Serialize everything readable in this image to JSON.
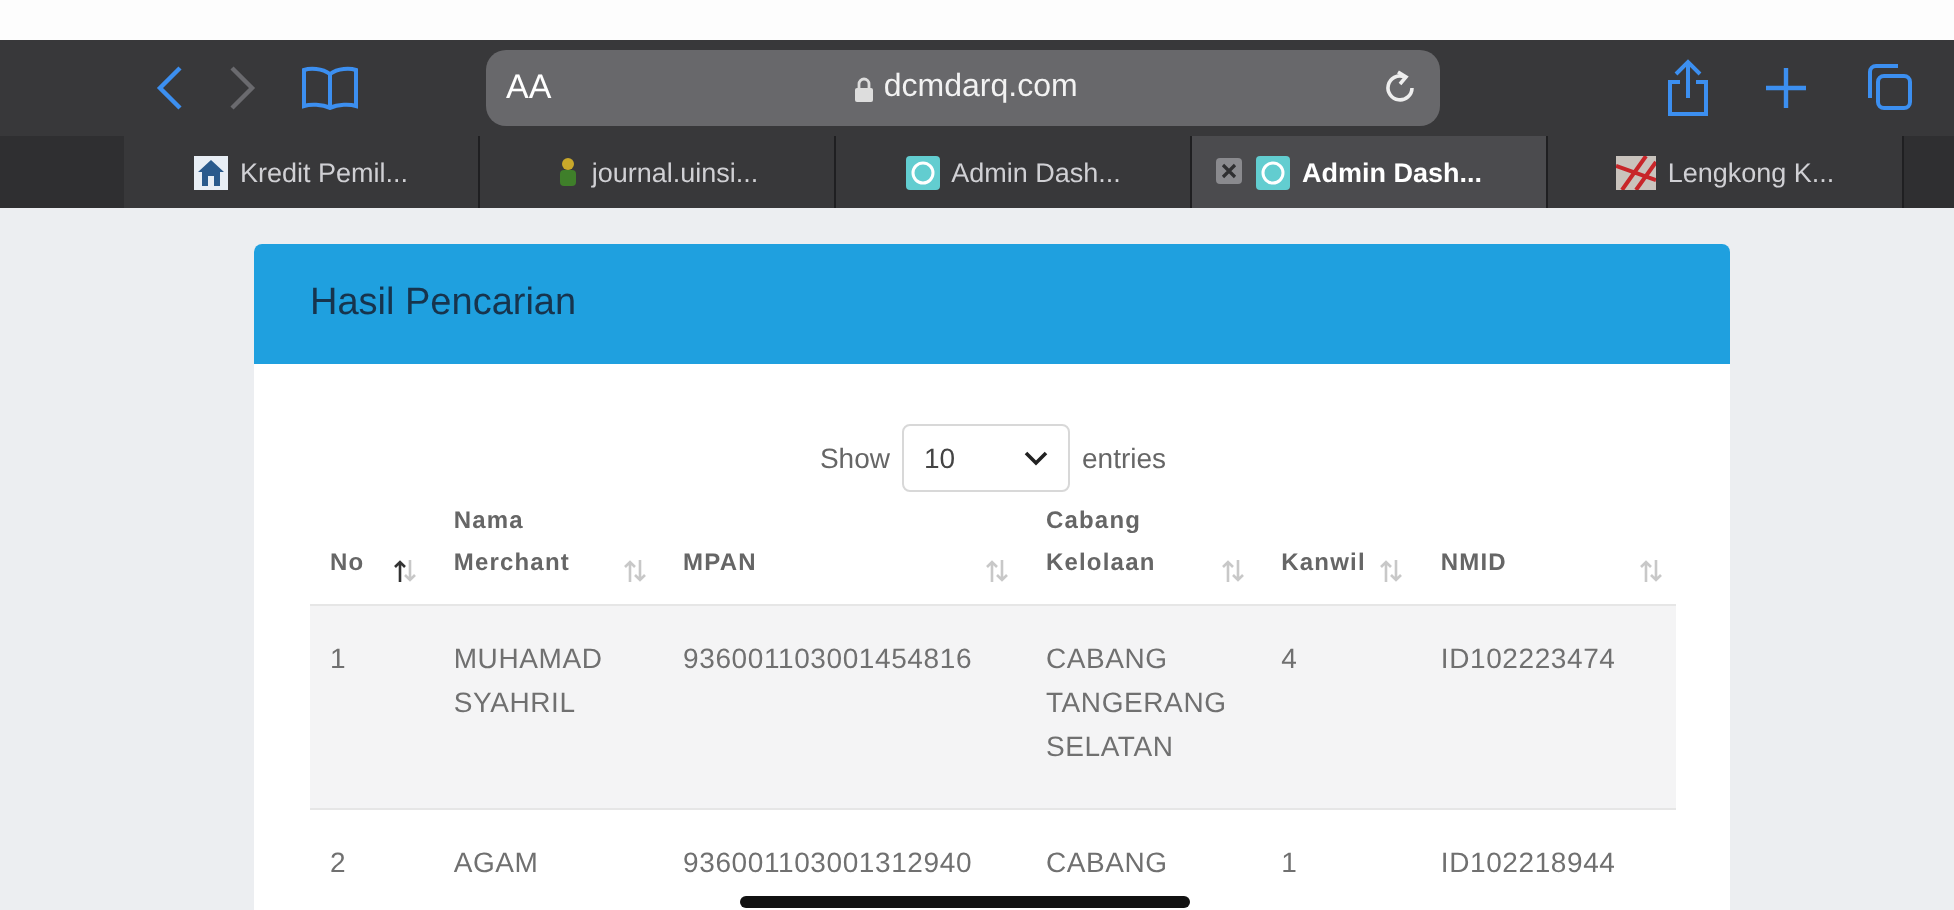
{
  "toolbar": {
    "font_button": "AA",
    "url": "dcmdarq.com",
    "back_disabled": false,
    "forward_disabled": true
  },
  "tabs": [
    {
      "label": "Kredit Pemil...",
      "selected": false
    },
    {
      "label": "journal.uinsi...",
      "selected": false
    },
    {
      "label": "Admin Dash...",
      "selected": false
    },
    {
      "label": "Admin Dash...",
      "selected": true
    },
    {
      "label": "Lengkong K...",
      "selected": false
    }
  ],
  "card": {
    "title": "Hasil Pencarian",
    "length": {
      "show_label": "Show",
      "value": "10",
      "entries_label": "entries"
    },
    "table": {
      "columns": [
        {
          "label": "No",
          "sorted_ascending": true
        },
        {
          "label": "Nama Merchant",
          "sorted_ascending": false
        },
        {
          "label": "MPAN",
          "sorted_ascending": false
        },
        {
          "label": "Cabang Kelolaan",
          "sorted_ascending": false
        },
        {
          "label": "Kanwil",
          "sorted_ascending": false
        },
        {
          "label": "NMID",
          "sorted_ascending": false
        }
      ],
      "rows": [
        [
          "1",
          "MUHAMAD SYAHRIL",
          "936001103001454816",
          "CABANG TANGERANG SELATAN",
          "4",
          "ID102223474"
        ],
        [
          "2",
          "AGAM",
          "936001103001312940",
          "CABANG",
          "1",
          "ID102218944"
        ]
      ]
    }
  }
}
